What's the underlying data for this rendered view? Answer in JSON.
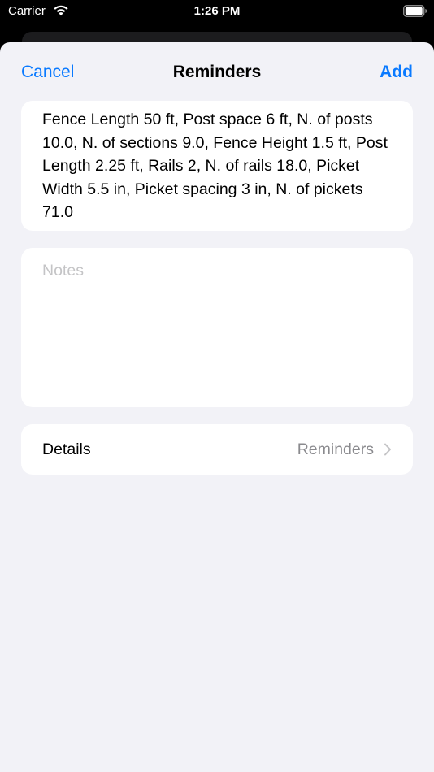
{
  "status_bar": {
    "carrier": "Carrier",
    "time": "1:26 PM",
    "icons": [
      "wifi-icon",
      "battery-icon"
    ]
  },
  "nav": {
    "cancel_label": "Cancel",
    "title": "Reminders",
    "add_label": "Add",
    "accent_color": "#0a7aff"
  },
  "reminder": {
    "title": "Fence Length 50 ft, Post space 6 ft, N. of posts 10.0, N. of sections 9.0, Fence Height 1.5 ft, Post Length 2.25 ft, Rails 2, N. of rails 18.0, Picket Width 5.5 in, Picket spacing 3 in, N. of pickets 71.0",
    "notes_placeholder": "Notes"
  },
  "details": {
    "label": "Details",
    "value": "Reminders",
    "icon": "chevron-right-icon"
  }
}
